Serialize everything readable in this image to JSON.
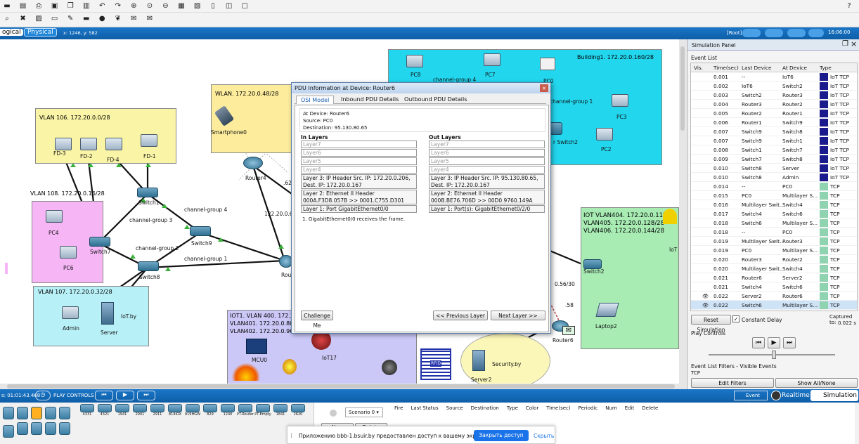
{
  "toolbar": {
    "help": "?"
  },
  "mode_bar": {
    "logical": "ogical",
    "physical": "Physical",
    "coords": "x: 1246, y: 582",
    "root": "[Root]",
    "clock": "16:06:00"
  },
  "zones": [
    {
      "label": "VLAN 106. 172.20.0.0/28"
    },
    {
      "label": "VLAN 108. 172.20.0.16/28"
    },
    {
      "label": "VLAN 107. 172.20.0.32/28"
    },
    {
      "label": "WLAN. 172.20.0.48/28"
    },
    {
      "label": "Building1. 172.20.0.160/28"
    },
    {
      "label": "IOT VLAN404. 172.20.0.112/28"
    },
    {
      "label": "VLAN405. 172.20.0.128/28"
    },
    {
      "label": "VLAN406. 172.20.0.144/28"
    },
    {
      "label": "IOT1. VLAN 400. 172.20."
    },
    {
      "label": "VLAN401. 172.20.0.80/28"
    },
    {
      "label": "VLAN402. 172.20.0.96/28"
    }
  ],
  "devices": {
    "fd3": "FD-3",
    "fd2": "FD-2",
    "fd4": "FD-4",
    "fd1": "FD-1",
    "pc4": "PC4",
    "pc6": "PC6",
    "switch7": "Switch7",
    "switch1": "Switch1",
    "switch9": "Switch9",
    "switch8": "Switch8",
    "admin": "Admin",
    "server": "Server",
    "iotby": "IoT.by",
    "smartphone": "Smartphone0",
    "router4": "Router4",
    "pc8": "PC8",
    "pc7": "PC7",
    "pc0": "PC0",
    "pc3": "PC3",
    "pc2": "PC2",
    "switch2r": "r Switch2",
    "switch2": "Switch2",
    "iot": "IoT",
    "laptop2": "Laptop2",
    "router6": "Router6",
    "rou": "Rou",
    "mcu0": "MCU0",
    "iot17": "IoT17",
    "securityby": "Security.by",
    "server2": "Server2",
    "rfid": "RFID"
  },
  "links": {
    "cg4a": "channel-group 4",
    "cg4b": "channel-group 4",
    "cg3": "channel-group 3",
    "cg2": "channel-group 2",
    "cg1": "channel-group 1",
    "cg1b": "channel-group 1",
    "ip1": "122.20.0.60",
    "ip2": ".62",
    "ip3": "0.56/30",
    "ip4": ".58"
  },
  "pdu_window": {
    "title": "PDU Information at Device: Router6",
    "tabs": [
      "OSI Model",
      "Inbound PDU Details",
      "Outbound PDU Details"
    ],
    "info": [
      "At Device: Router6",
      "Source: PC0",
      "Destination: 95.130.80.65"
    ],
    "in_header": "In Layers",
    "out_header": "Out Layers",
    "in_layers": [
      "Layer7",
      "Layer6",
      "Layer5",
      "Layer4",
      "Layer 3: IP Header Src. IP: 172.20.0.206, Dest. IP: 172.20.0.167",
      "Layer 2: Ethernet II Header 000A.F3D8.057B >> 0001.C755.D301",
      "Layer 1: Port GigabitEthernet0/0"
    ],
    "out_layers": [
      "Layer7",
      "Layer6",
      "Layer5",
      "Layer4",
      "Layer 3: IP Header Src. IP: 95.130.80.65, Dest. IP: 172.20.0.167",
      "Layer 2: Ethernet II Header 000B.BE76.706D >> 00D0.9760.149A",
      "Layer 1: Port(s): GigabitEthernet0/2/0"
    ],
    "note": "1. GigabitEthernet0/0 receives the frame.",
    "challenge": "Challenge Me",
    "prev": "<< Previous Layer",
    "next": "Next Layer >>"
  },
  "sim_panel": {
    "title": "Simulation Panel",
    "event_list": "Event List",
    "columns": [
      "Vis.",
      "Time(sec)",
      "Last Device",
      "At Device",
      "Type"
    ],
    "events": [
      {
        "vis": "",
        "time": "0.001",
        "last": "--",
        "at": "IoT6",
        "type": "IoT TCP",
        "color": "#1a1a8c"
      },
      {
        "vis": "",
        "time": "0.002",
        "last": "IoT6",
        "at": "Switch2",
        "type": "IoT TCP",
        "color": "#1a1a8c"
      },
      {
        "vis": "",
        "time": "0.003",
        "last": "Switch2",
        "at": "Router3",
        "type": "IoT TCP",
        "color": "#1a1a8c"
      },
      {
        "vis": "",
        "time": "0.004",
        "last": "Router3",
        "at": "Router2",
        "type": "IoT TCP",
        "color": "#1a1a8c"
      },
      {
        "vis": "",
        "time": "0.005",
        "last": "Router2",
        "at": "Router1",
        "type": "IoT TCP",
        "color": "#1a1a8c"
      },
      {
        "vis": "",
        "time": "0.006",
        "last": "Router1",
        "at": "Switch9",
        "type": "IoT TCP",
        "color": "#1a1a8c"
      },
      {
        "vis": "",
        "time": "0.007",
        "last": "Switch9",
        "at": "Switch8",
        "type": "IoT TCP",
        "color": "#1a1a8c"
      },
      {
        "vis": "",
        "time": "0.007",
        "last": "Switch9",
        "at": "Switch1",
        "type": "IoT TCP",
        "color": "#1a1a8c"
      },
      {
        "vis": "",
        "time": "0.008",
        "last": "Switch1",
        "at": "Switch7",
        "type": "IoT TCP",
        "color": "#1a1a8c"
      },
      {
        "vis": "",
        "time": "0.009",
        "last": "Switch7",
        "at": "Switch8",
        "type": "IoT TCP",
        "color": "#1a1a8c"
      },
      {
        "vis": "",
        "time": "0.010",
        "last": "Switch8",
        "at": "Server",
        "type": "IoT TCP",
        "color": "#1a1a8c"
      },
      {
        "vis": "",
        "time": "0.010",
        "last": "Switch8",
        "at": "Admin",
        "type": "IoT TCP",
        "color": "#1a1a8c"
      },
      {
        "vis": "",
        "time": "0.014",
        "last": "--",
        "at": "PC0",
        "type": "TCP",
        "color": "#8fd3b0"
      },
      {
        "vis": "",
        "time": "0.015",
        "last": "PC0",
        "at": "Multilayer S...",
        "type": "TCP",
        "color": "#8fd3b0"
      },
      {
        "vis": "",
        "time": "0.016",
        "last": "Multilayer Swit...",
        "at": "Switch4",
        "type": "TCP",
        "color": "#8fd3b0"
      },
      {
        "vis": "",
        "time": "0.017",
        "last": "Switch4",
        "at": "Switch6",
        "type": "TCP",
        "color": "#8fd3b0"
      },
      {
        "vis": "",
        "time": "0.018",
        "last": "Switch6",
        "at": "Multilayer S...",
        "type": "TCP",
        "color": "#8fd3b0"
      },
      {
        "vis": "",
        "time": "0.018",
        "last": "--",
        "at": "PC0",
        "type": "TCP",
        "color": "#8fd3b0"
      },
      {
        "vis": "",
        "time": "0.019",
        "last": "Multilayer Swit...",
        "at": "Router3",
        "type": "TCP",
        "color": "#8fd3b0"
      },
      {
        "vis": "",
        "time": "0.019",
        "last": "PC0",
        "at": "Multilayer S...",
        "type": "TCP",
        "color": "#8fd3b0"
      },
      {
        "vis": "",
        "time": "0.020",
        "last": "Router3",
        "at": "Router2",
        "type": "TCP",
        "color": "#8fd3b0"
      },
      {
        "vis": "",
        "time": "0.020",
        "last": "Multilayer Swit...",
        "at": "Switch4",
        "type": "TCP",
        "color": "#8fd3b0"
      },
      {
        "vis": "",
        "time": "0.021",
        "last": "Router6",
        "at": "Server2",
        "type": "TCP",
        "color": "#8fd3b0"
      },
      {
        "vis": "",
        "time": "0.021",
        "last": "Switch4",
        "at": "Switch6",
        "type": "TCP",
        "color": "#8fd3b0"
      },
      {
        "vis": "eye",
        "time": "0.022",
        "last": "Server2",
        "at": "Router6",
        "type": "TCP",
        "color": "#8fd3b0"
      },
      {
        "vis": "eye",
        "time": "0.022",
        "last": "Switch6",
        "at": "Multilayer S...",
        "type": "TCP",
        "color": "#8fd3b0"
      }
    ],
    "reset": "Reset Simulation",
    "constant_delay": "Constant Delay",
    "captured_label": "Captured to:",
    "captured_value": "0.022 s",
    "play_controls": "Play Controls",
    "filters_label": "Event List Filters - Visible Events",
    "filters_value": "TCP",
    "edit_filters": "Edit Filters",
    "show_all": "Show All/None"
  },
  "bottom": {
    "time": "s: 01:01:43.468",
    "play_controls": "PLAY CONTROLS",
    "event_list": "Event List",
    "realtime": "Realtime",
    "simulation": "Simulation",
    "models": [
      "4331",
      "4321",
      "1941",
      "2901",
      "2911",
      "819IOX",
      "819HGW",
      "829",
      "1240",
      "PT-Router",
      "PT-Empty",
      "1841",
      "2620"
    ],
    "scenario": "Scenario 0",
    "new_btn": "New",
    "delete_btn": "Delete",
    "pdu_columns": [
      "Fire",
      "Last Status",
      "Source",
      "Destination",
      "Type",
      "Color",
      "Time(sec)",
      "Periodic",
      "Num",
      "Edit",
      "Delete"
    ]
  },
  "notification": {
    "text": "Приложению bbb-1.bsuir.by предоставлен доступ к вашему экрану.",
    "close": "Закрыть доступ",
    "hide": "Скрыть"
  }
}
